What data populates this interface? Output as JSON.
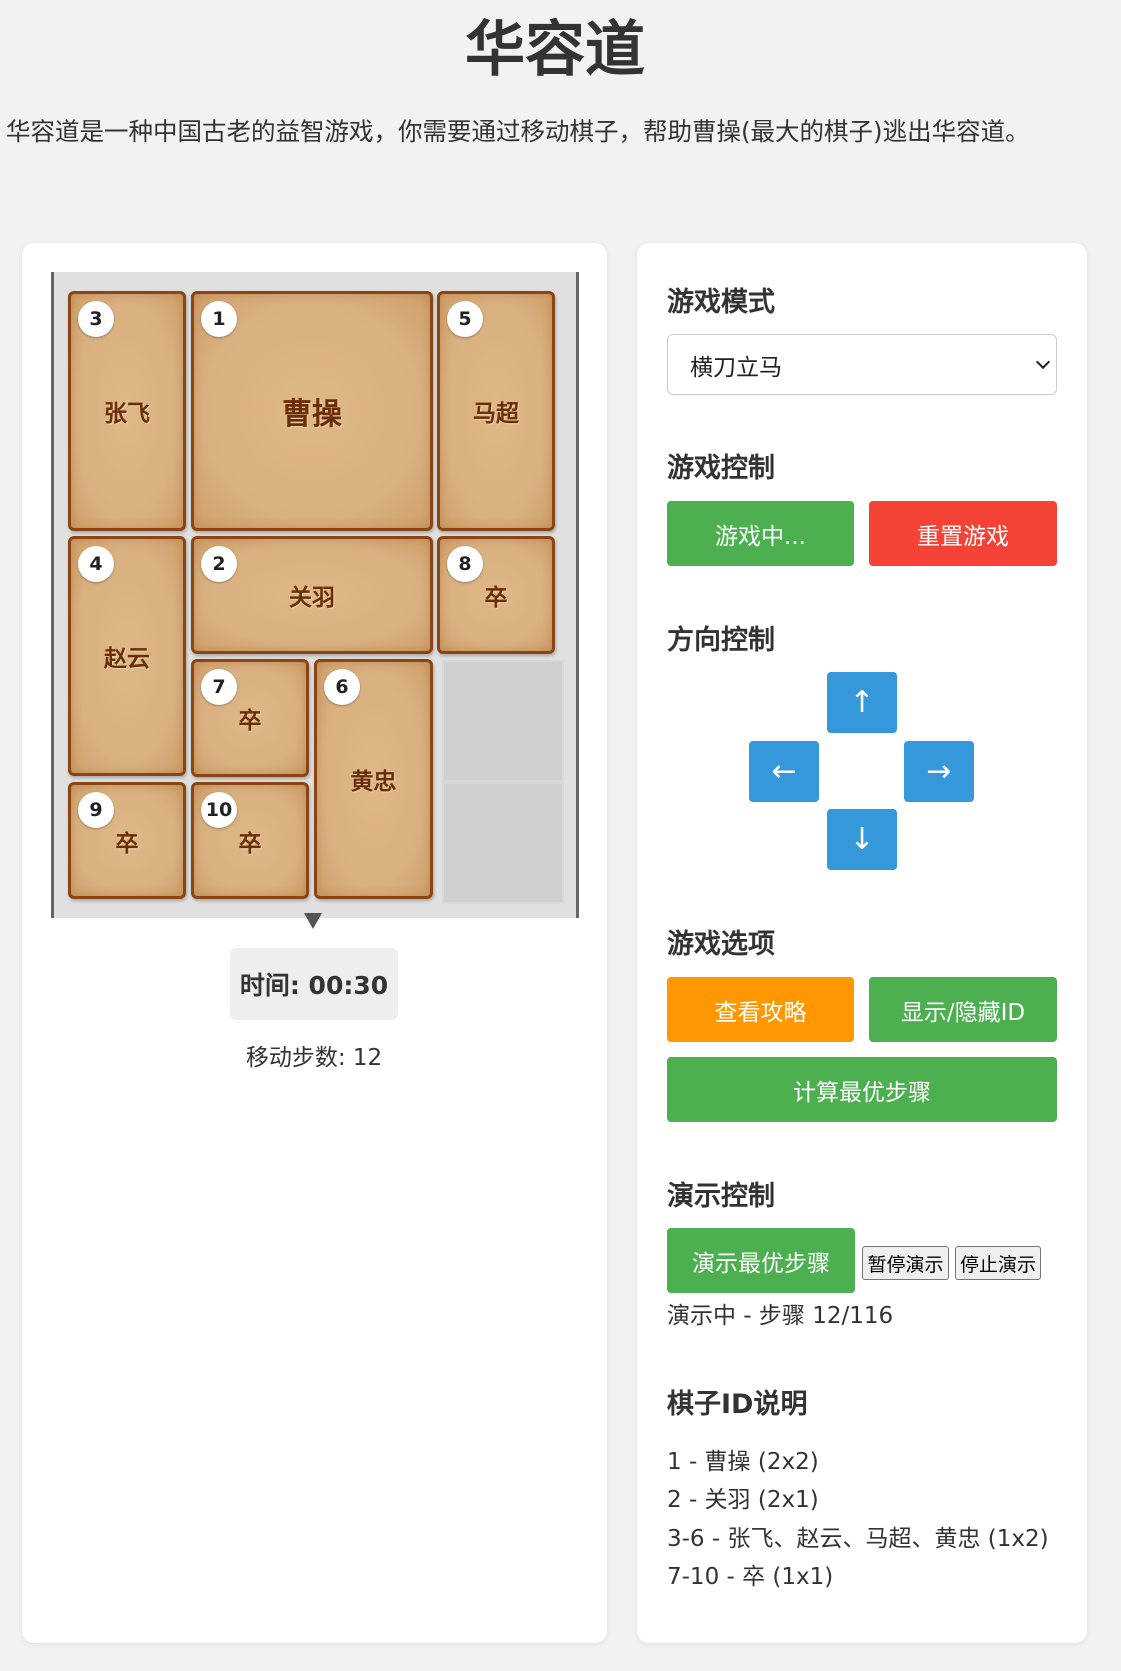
{
  "header": {
    "title": "华容道",
    "intro": "华容道是一种中国古老的益智游戏，你需要通过移动棋子，帮助曹操(最大的棋子)逃出华容道。"
  },
  "board": {
    "pieces": [
      {
        "id": "3",
        "name": "张飞"
      },
      {
        "id": "1",
        "name": "曹操"
      },
      {
        "id": "5",
        "name": "马超"
      },
      {
        "id": "4",
        "name": "赵云"
      },
      {
        "id": "2",
        "name": "关羽"
      },
      {
        "id": "8",
        "name": "卒"
      },
      {
        "id": "7",
        "name": "卒"
      },
      {
        "id": "6",
        "name": "黄忠"
      },
      {
        "id": "9",
        "name": "卒"
      },
      {
        "id": "10",
        "name": "卒"
      }
    ]
  },
  "status": {
    "timer": "时间: 00:30",
    "moves": "移动步数: 12"
  },
  "mode": {
    "title": "游戏模式",
    "selected": "横刀立马"
  },
  "control": {
    "title": "游戏控制",
    "start_label": "游戏中...",
    "reset_label": "重置游戏"
  },
  "direction": {
    "title": "方向控制",
    "up": "↑",
    "left": "←",
    "right": "→",
    "down": "↓"
  },
  "options": {
    "title": "游戏选项",
    "guide_label": "查看攻略",
    "toggle_id_label": "显示/隐藏ID",
    "compute_label": "计算最优步骤"
  },
  "demo": {
    "title": "演示控制",
    "play_label": "演示最优步骤",
    "pause_label": "暂停演示",
    "stop_label": "停止演示",
    "status": "演示中 - 步骤 12/116"
  },
  "legend": {
    "title": "棋子ID说明",
    "items": [
      "1 - 曹操 (2x2)",
      "2 - 关羽 (2x1)",
      "3-6 - 张飞、赵云、马超、黄忠 (1x2)",
      "7-10 - 卒 (1x1)"
    ]
  },
  "colors": {
    "piece_fill": "#deb887",
    "piece_border": "#8b4513",
    "green": "#4caf50",
    "red": "#f44336",
    "orange": "#ff9800",
    "blue": "#3498db"
  }
}
